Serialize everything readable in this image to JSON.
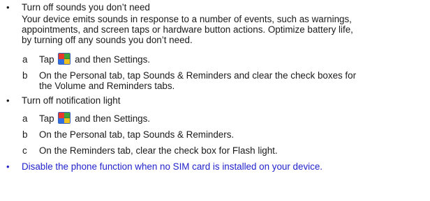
{
  "items": [
    {
      "bullet": "•",
      "title": "Turn off sounds you don’t need",
      "body": [
        "Your device emits sounds in response to a number of events, such as warnings,",
        "appointments, and screen taps or hardware button actions. Optimize battery life,",
        "by turning off any sounds you don’t need."
      ],
      "steps": [
        {
          "letter": "a",
          "pre": "Tap",
          "post": "and then Settings."
        },
        {
          "letter": "b",
          "lines": [
            "On the Personal tab, tap Sounds & Reminders and clear the check boxes for",
            "the Volume and Reminders tabs."
          ]
        }
      ]
    },
    {
      "bullet": "•",
      "title": "Turn off notification light",
      "steps": [
        {
          "letter": "a",
          "pre": "Tap",
          "post": "and then Settings."
        },
        {
          "letter": "b",
          "lines": [
            "On the Personal tab, tap Sounds & Reminders."
          ]
        },
        {
          "letter": "c",
          "lines": [
            "On the Reminders tab, clear the check box for Flash light."
          ]
        }
      ]
    },
    {
      "bullet": "•",
      "title": "Disable the phone function when no SIM card is installed on your device.",
      "color": "#2222cc"
    }
  ],
  "icons": {
    "start": "windows-start-icon"
  }
}
